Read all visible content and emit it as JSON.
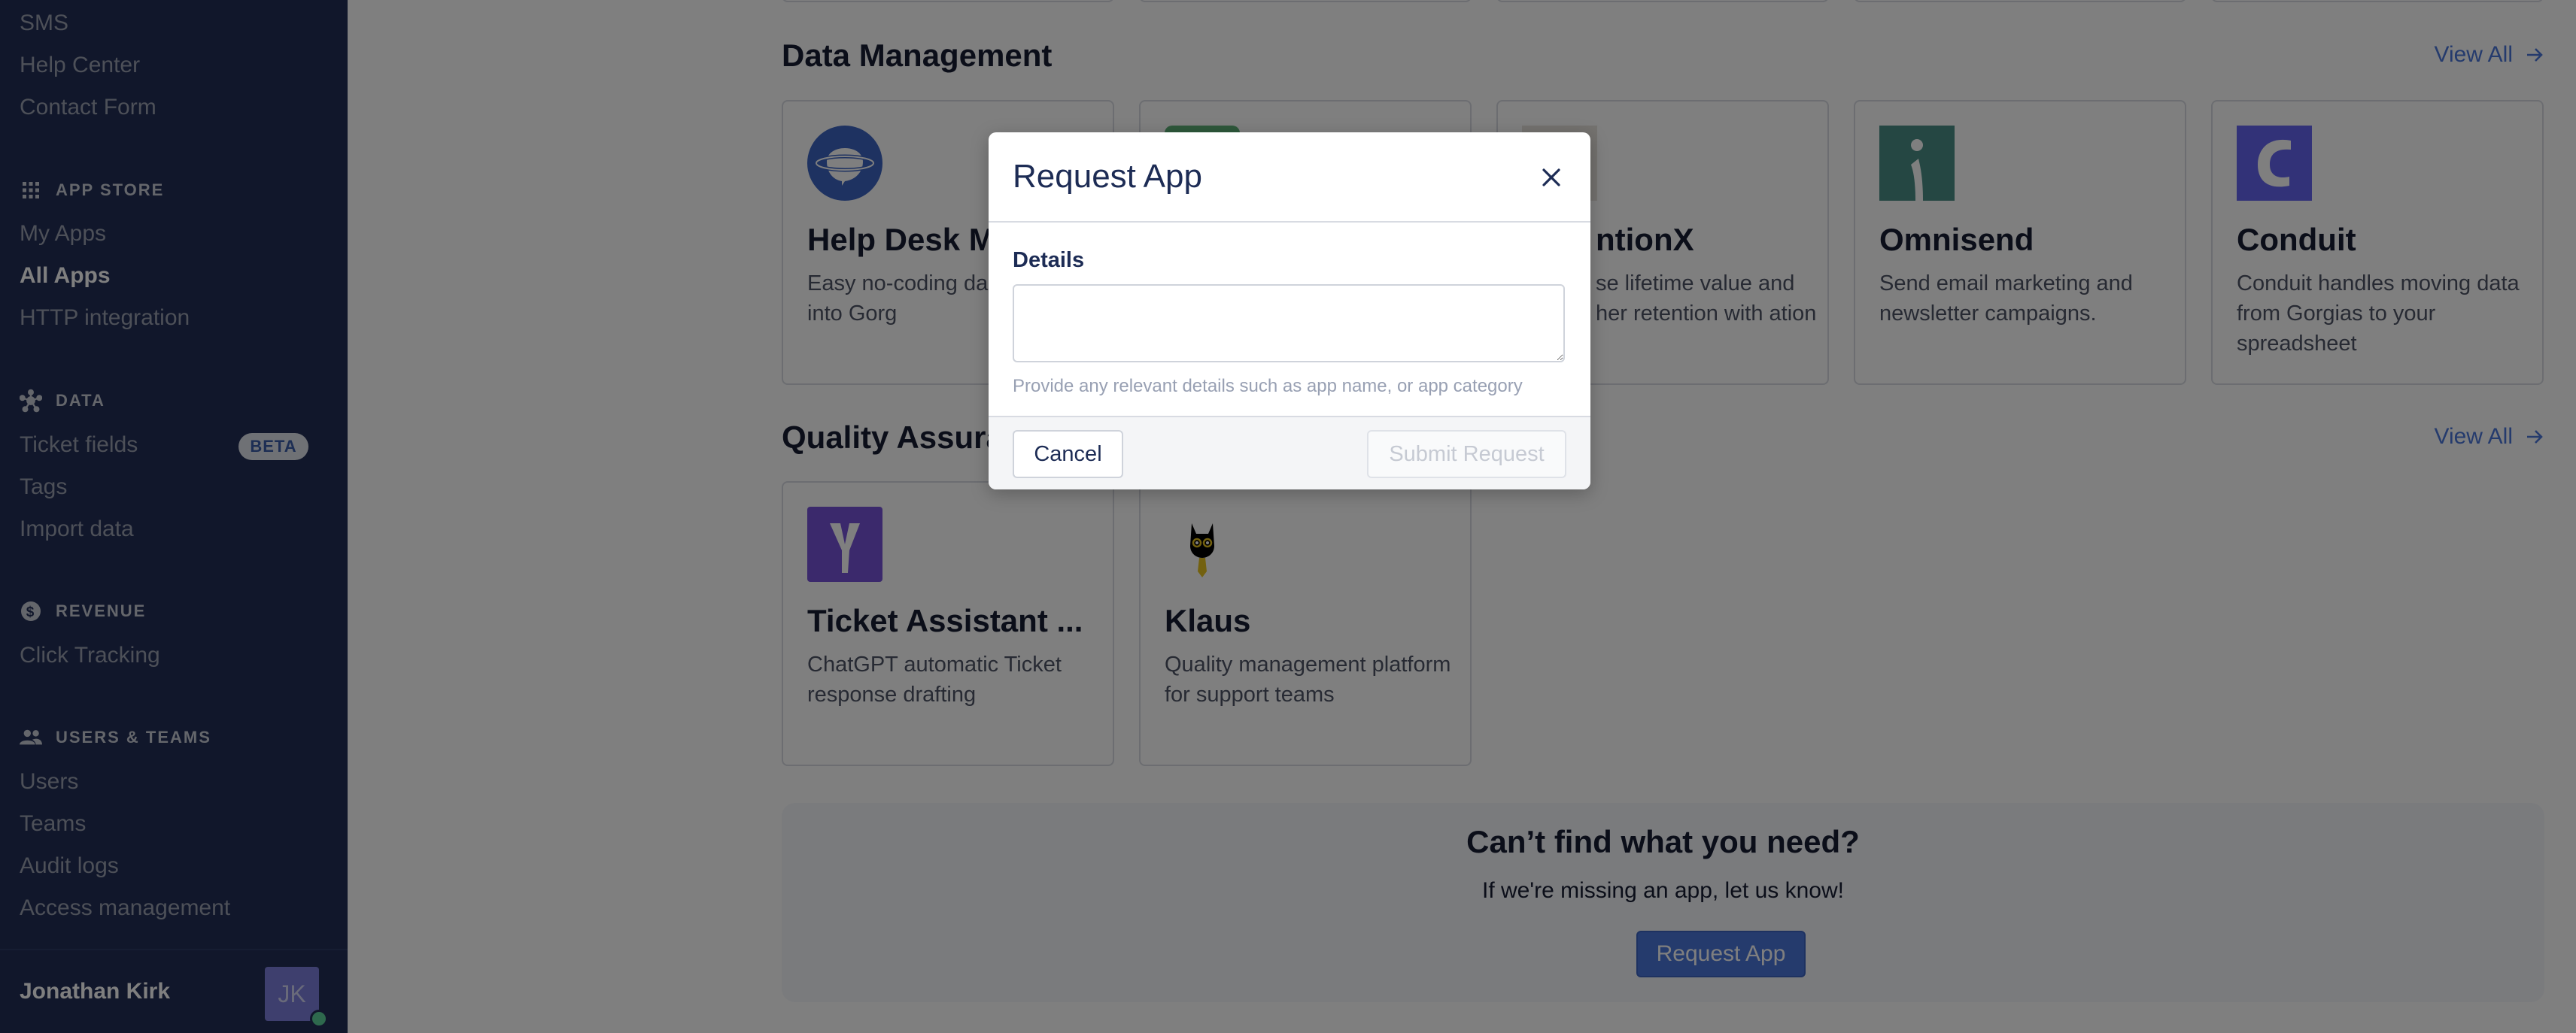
{
  "sidebar": {
    "top_items": [
      {
        "label": "SMS"
      },
      {
        "label": "Help Center"
      },
      {
        "label": "Contact Form"
      }
    ],
    "sections": [
      {
        "title": "APP STORE",
        "icon": "grid-icon",
        "items": [
          {
            "label": "My Apps",
            "active": false
          },
          {
            "label": "All Apps",
            "active": true
          },
          {
            "label": "HTTP integration",
            "active": false
          }
        ]
      },
      {
        "title": "DATA",
        "icon": "nodes-icon",
        "items": [
          {
            "label": "Ticket fields",
            "badge": "BETA"
          },
          {
            "label": "Tags"
          },
          {
            "label": "Import data"
          }
        ]
      },
      {
        "title": "REVENUE",
        "icon": "dollar-circle-icon",
        "items": [
          {
            "label": "Click Tracking"
          }
        ]
      },
      {
        "title": "USERS & TEAMS",
        "icon": "users-icon",
        "items": [
          {
            "label": "Users"
          },
          {
            "label": "Teams"
          },
          {
            "label": "Audit logs"
          },
          {
            "label": "Access management"
          }
        ]
      }
    ],
    "user": {
      "name": "Jonathan Kirk",
      "initials": "JK",
      "status": "online"
    }
  },
  "main": {
    "sections": [
      {
        "title": "Data Management",
        "view_all": "View All",
        "cards": [
          {
            "title": "Help Desk M",
            "description": "Easy no-coding da migration into Gorg",
            "logo": "helpdesk-planet-icon"
          },
          {
            "title": "",
            "description": "",
            "logo": "green-app-icon"
          },
          {
            "title": "ntionX",
            "description": "se lifetime value and her retention with ation",
            "logo": "grey-app-icon"
          },
          {
            "title": "Omnisend",
            "description": "Send email marketing and newsletter campaigns.",
            "logo": "omnisend-icon"
          },
          {
            "title": "Conduit",
            "description": "Conduit handles moving data from Gorgias to your spreadsheet",
            "logo": "conduit-icon"
          }
        ]
      },
      {
        "title": "Quality Assurance",
        "view_all": "View All",
        "cards": [
          {
            "title": "Ticket Assistant ...",
            "description": "ChatGPT automatic Ticket response drafting",
            "logo": "ticket-assistant-icon"
          },
          {
            "title": "Klaus",
            "description": "Quality management platform for support teams",
            "logo": "klaus-cat-icon"
          }
        ]
      }
    ],
    "cta": {
      "title": "Can’t find what you need?",
      "subtitle": "If we're missing an app, let us know!",
      "button": "Request App"
    }
  },
  "modal": {
    "title": "Request App",
    "field_label": "Details",
    "field_value": "",
    "field_placeholder": "",
    "help_text": "Provide any relevant details such as app name, or app category",
    "cancel_label": "Cancel",
    "submit_label": "Submit Request",
    "submit_enabled": false
  },
  "colors": {
    "sidebar_bg": "#232f57",
    "accent": "#4a76db",
    "title_text": "#1d2c55",
    "omnisend": "#4b8e86",
    "conduit": "#6465f1",
    "ticket_assistant": "#7752d8",
    "helpdesk": "#3c64c2",
    "presence": "#5cd29a"
  }
}
